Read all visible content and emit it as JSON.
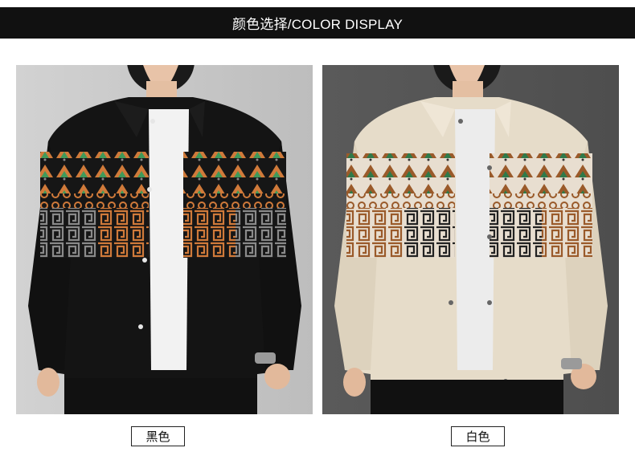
{
  "header": {
    "title": "颜色选择/COLOR DISPLAY"
  },
  "products": [
    {
      "caption": "黑色",
      "cardigan_color": "#141414",
      "background": "#c9c9c9"
    },
    {
      "caption": "白色",
      "cardigan_color": "#e6dcc9",
      "background": "#5b5b5b"
    }
  ]
}
